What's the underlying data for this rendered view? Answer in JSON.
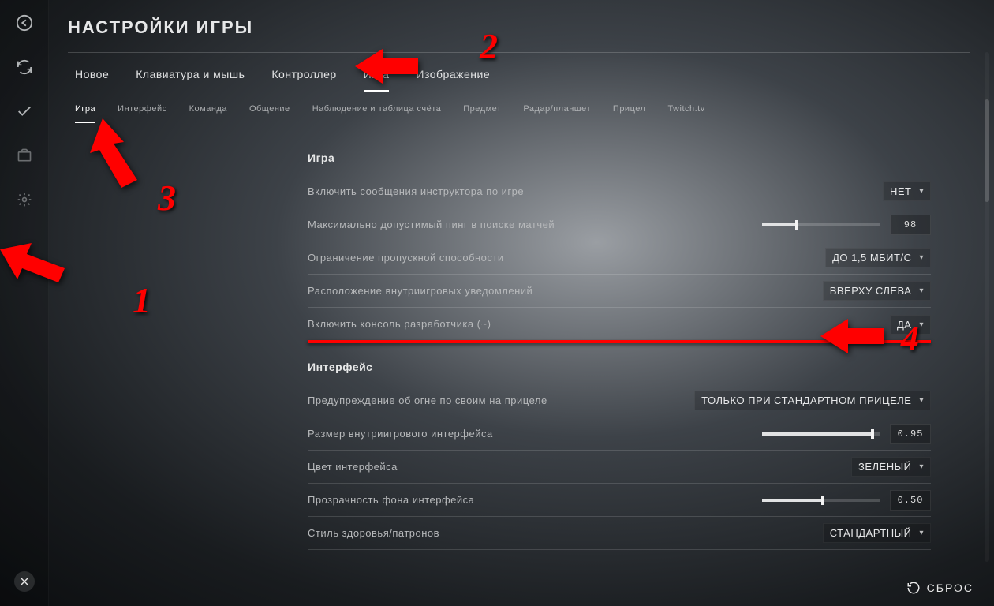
{
  "page_title": "НАСТРОЙКИ ИГРЫ",
  "primary_tabs": [
    "Новое",
    "Клавиатура и мышь",
    "Контроллер",
    "Игра",
    "Изображение"
  ],
  "primary_active": 3,
  "secondary_tabs": [
    "Игра",
    "Интерфейс",
    "Команда",
    "Общение",
    "Наблюдение и таблица счёта",
    "Предмет",
    "Радар/планшет",
    "Прицел",
    "Twitch.tv"
  ],
  "secondary_active": 0,
  "section_game": {
    "title": "Игра",
    "instructor_msgs": {
      "label": "Включить сообщения инструктора по игре",
      "value": "НЕТ"
    },
    "max_ping": {
      "label": "Максимально допустимый пинг в поиске матчей",
      "value": "98",
      "fill_pct": 28
    },
    "bandwidth": {
      "label": "Ограничение пропускной способности",
      "value": "ДО 1,5 МБИТ/С"
    },
    "notif_pos": {
      "label": "Расположение внутриигровых уведомлений",
      "value": "ВВЕРХУ СЛЕВА"
    },
    "dev_console": {
      "label": "Включить консоль разработчика (~)",
      "value": "ДА"
    }
  },
  "section_interface": {
    "title": "Интерфейс",
    "ff_warning": {
      "label": "Предупреждение об огне по своим на прицеле",
      "value": "ТОЛЬКО ПРИ СТАНДАРТНОМ ПРИЦЕЛЕ"
    },
    "hud_scale": {
      "label": "Размер внутриигрового интерфейса",
      "value": "0.95",
      "fill_pct": 92
    },
    "hud_color": {
      "label": "Цвет интерфейса",
      "value": "ЗЕЛЁНЫЙ"
    },
    "bg_alpha": {
      "label": "Прозрачность фона интерфейса",
      "value": "0.50",
      "fill_pct": 50
    },
    "health_style": {
      "label": "Стиль здоровья/патронов",
      "value": "СТАНДАРТНЫЙ"
    }
  },
  "reset_label": "СБРОС",
  "annotations": {
    "a1": "1",
    "a2": "2",
    "a3": "3",
    "a4": "4"
  }
}
